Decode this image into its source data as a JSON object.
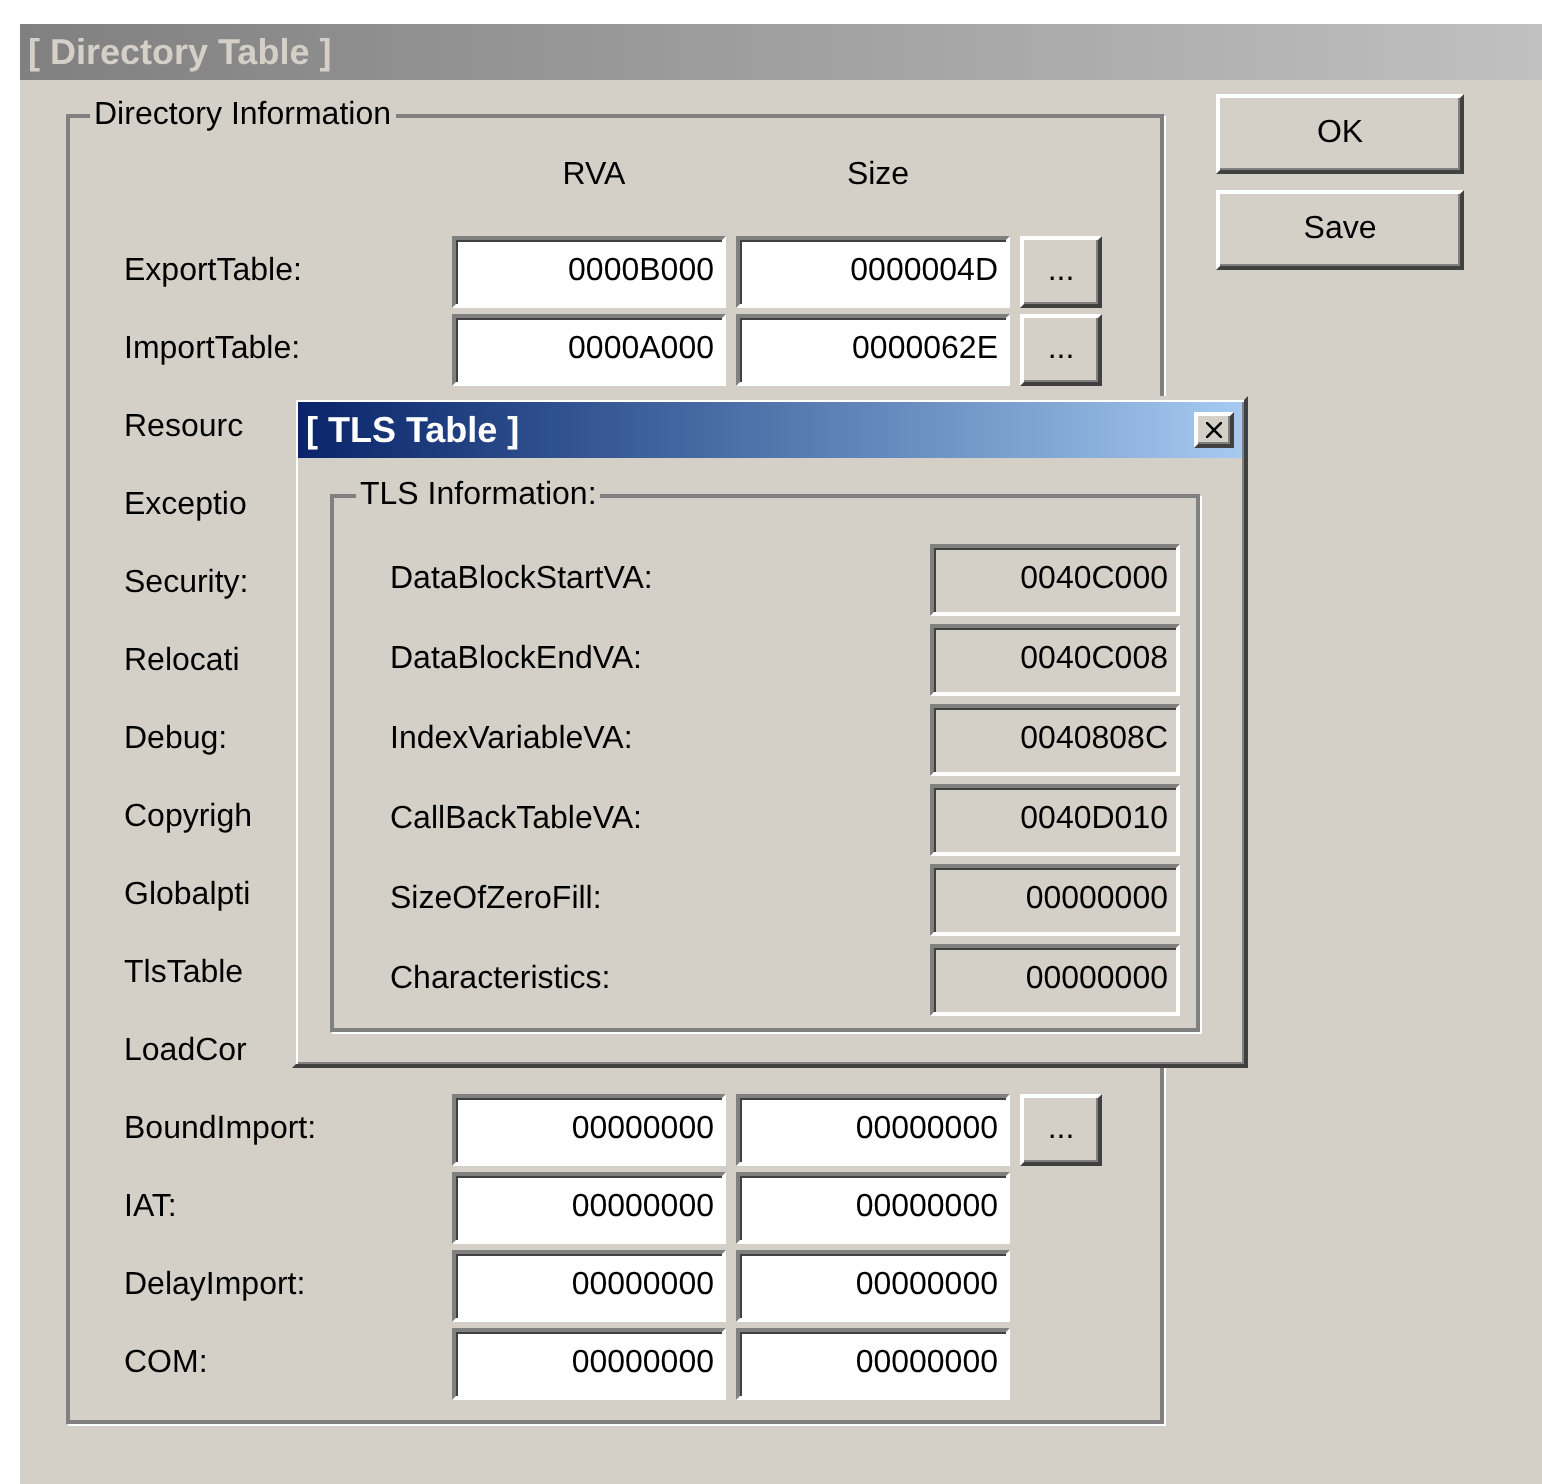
{
  "window": {
    "title": "[ Directory Table ]",
    "active": false
  },
  "directory": {
    "legend": "Directory Information",
    "column_headers": [
      "RVA",
      "Size"
    ],
    "rows": [
      {
        "label": "ExportTable:",
        "rva": "0000B000",
        "size": "0000004D",
        "details_button": true
      },
      {
        "label": "ImportTable:",
        "rva": "0000A000",
        "size": "0000062E",
        "details_button": true
      },
      {
        "label": "Resourc"
      },
      {
        "label": "Exceptio"
      },
      {
        "label": "Security:"
      },
      {
        "label": "Relocati"
      },
      {
        "label": "Debug:"
      },
      {
        "label": "Copyrigh"
      },
      {
        "label": "Globalpti"
      },
      {
        "label": "TlsTable"
      },
      {
        "label": "LoadCor"
      },
      {
        "label": "BoundImport:",
        "rva": "00000000",
        "size": "00000000",
        "details_button": true
      },
      {
        "label": "IAT:",
        "rva": "00000000",
        "size": "00000000",
        "details_button": false
      },
      {
        "label": "DelayImport:",
        "rva": "00000000",
        "size": "00000000",
        "details_button": false
      },
      {
        "label": "COM:",
        "rva": "00000000",
        "size": "00000000",
        "details_button": false
      }
    ],
    "details_button_label": "..."
  },
  "buttons": [
    "OK",
    "Save"
  ],
  "tls_dialog": {
    "title": "[ TLS Table ]",
    "active": true,
    "legend": "TLS Information:",
    "fields": [
      {
        "label": "DataBlockStartVA:",
        "value": "0040C000"
      },
      {
        "label": "DataBlockEndVA:",
        "value": "0040C008"
      },
      {
        "label": "IndexVariableVA:",
        "value": "0040808C"
      },
      {
        "label": "CallBackTableVA:",
        "value": "0040D010"
      },
      {
        "label": "SizeOfZeroFill:",
        "value": "00000000"
      },
      {
        "label": "Characteristics:",
        "value": "00000000"
      }
    ]
  }
}
